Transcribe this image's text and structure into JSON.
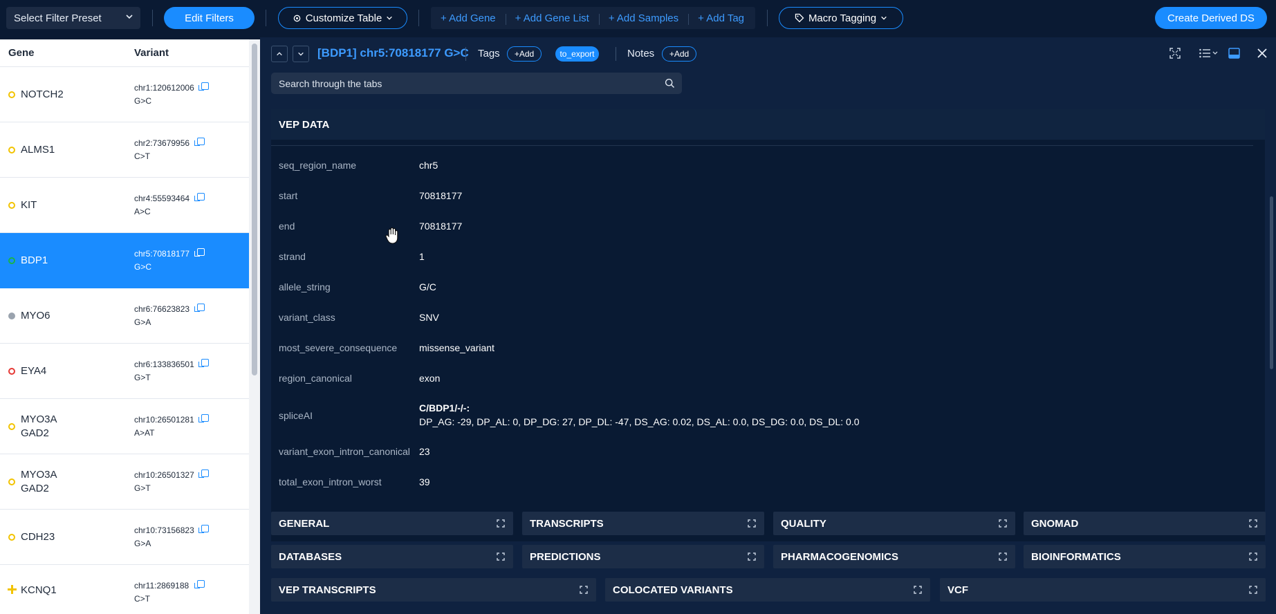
{
  "topbar": {
    "filter_preset": "Select Filter Preset",
    "edit_filters": "Edit Filters",
    "customize_table": "Customize Table",
    "add_gene": "+ Add Gene",
    "add_gene_list": "+ Add Gene List",
    "add_samples": "+ Add Samples",
    "add_tag": "+ Add Tag",
    "macro_tagging": "Macro Tagging",
    "create_derived": "Create Derived DS"
  },
  "table": {
    "col_gene": "Gene",
    "col_variant": "Variant",
    "rows": [
      {
        "gene": "NOTCH2",
        "gene2": "",
        "pos": "chr1:120612006",
        "alt": "G>C",
        "status": "yellow"
      },
      {
        "gene": "ALMS1",
        "gene2": "",
        "pos": "chr2:73679956",
        "alt": "C>T",
        "status": "yellow"
      },
      {
        "gene": "KIT",
        "gene2": "",
        "pos": "chr4:55593464",
        "alt": "A>C",
        "status": "yellow"
      },
      {
        "gene": "BDP1",
        "gene2": "",
        "pos": "chr5:70818177",
        "alt": "G>C",
        "status": "green"
      },
      {
        "gene": "MYO6",
        "gene2": "",
        "pos": "chr6:76623823",
        "alt": "G>A",
        "status": "gray"
      },
      {
        "gene": "EYA4",
        "gene2": "",
        "pos": "chr6:133836501",
        "alt": "G>T",
        "status": "red"
      },
      {
        "gene": "MYO3A",
        "gene2": "GAD2",
        "pos": "chr10:26501281",
        "alt": "A>AT",
        "status": "yellow"
      },
      {
        "gene": "MYO3A",
        "gene2": "GAD2",
        "pos": "chr10:26501327",
        "alt": "G>T",
        "status": "yellow"
      },
      {
        "gene": "CDH23",
        "gene2": "",
        "pos": "chr10:73156823",
        "alt": "G>A",
        "status": "yellow"
      },
      {
        "gene": "KCNQ1",
        "gene2": "",
        "pos": "chr11:2869188",
        "alt": "C>T",
        "status": "plus"
      }
    ]
  },
  "detail": {
    "title": "[BDP1] chr5:70818177 G>C",
    "tags_label": "Tags",
    "add_tag_pill": "+Add",
    "tag_value": "to_export",
    "notes_label": "Notes",
    "add_note_pill": "+Add",
    "search_placeholder": "Search through the tabs",
    "vep_title": "VEP DATA",
    "fields": [
      {
        "key": "seq_region_name",
        "value": "chr5"
      },
      {
        "key": "start",
        "value": "70818177"
      },
      {
        "key": "end",
        "value": "70818177"
      },
      {
        "key": "strand",
        "value": "1"
      },
      {
        "key": "allele_string",
        "value": "G/C"
      },
      {
        "key": "variant_class",
        "value": "SNV"
      },
      {
        "key": "most_severe_consequence",
        "value": "missense_variant"
      },
      {
        "key": "region_canonical",
        "value": "exon"
      },
      {
        "key": "spliceAI",
        "value": "C/BDP1/-/-:",
        "value2": "DP_AG: -29, DP_AL: 0, DP_DG: 27, DP_DL: -47, DS_AG: 0.02, DS_AL: 0.0, DS_DG: 0.0, DS_DL: 0.0"
      },
      {
        "key": "variant_exon_intron_canonical",
        "value": "23"
      },
      {
        "key": "total_exon_intron_worst",
        "value": "39"
      }
    ],
    "cards_row1": [
      "GENERAL",
      "TRANSCRIPTS",
      "QUALITY",
      "GNOMAD"
    ],
    "cards_row2": [
      "DATABASES",
      "PREDICTIONS",
      "PHARMACOGENOMICS",
      "BIOINFORMATICS"
    ],
    "cards_row3": [
      "VEP TRANSCRIPTS",
      "COLOCATED VARIANTS",
      "VCF"
    ]
  },
  "colors": {
    "accent": "#1a8cff",
    "background": "#0a1a33",
    "status_yellow": "#f2c300",
    "status_green": "#19b34a",
    "status_gray": "#9aa3ae",
    "status_red": "#e53935"
  }
}
